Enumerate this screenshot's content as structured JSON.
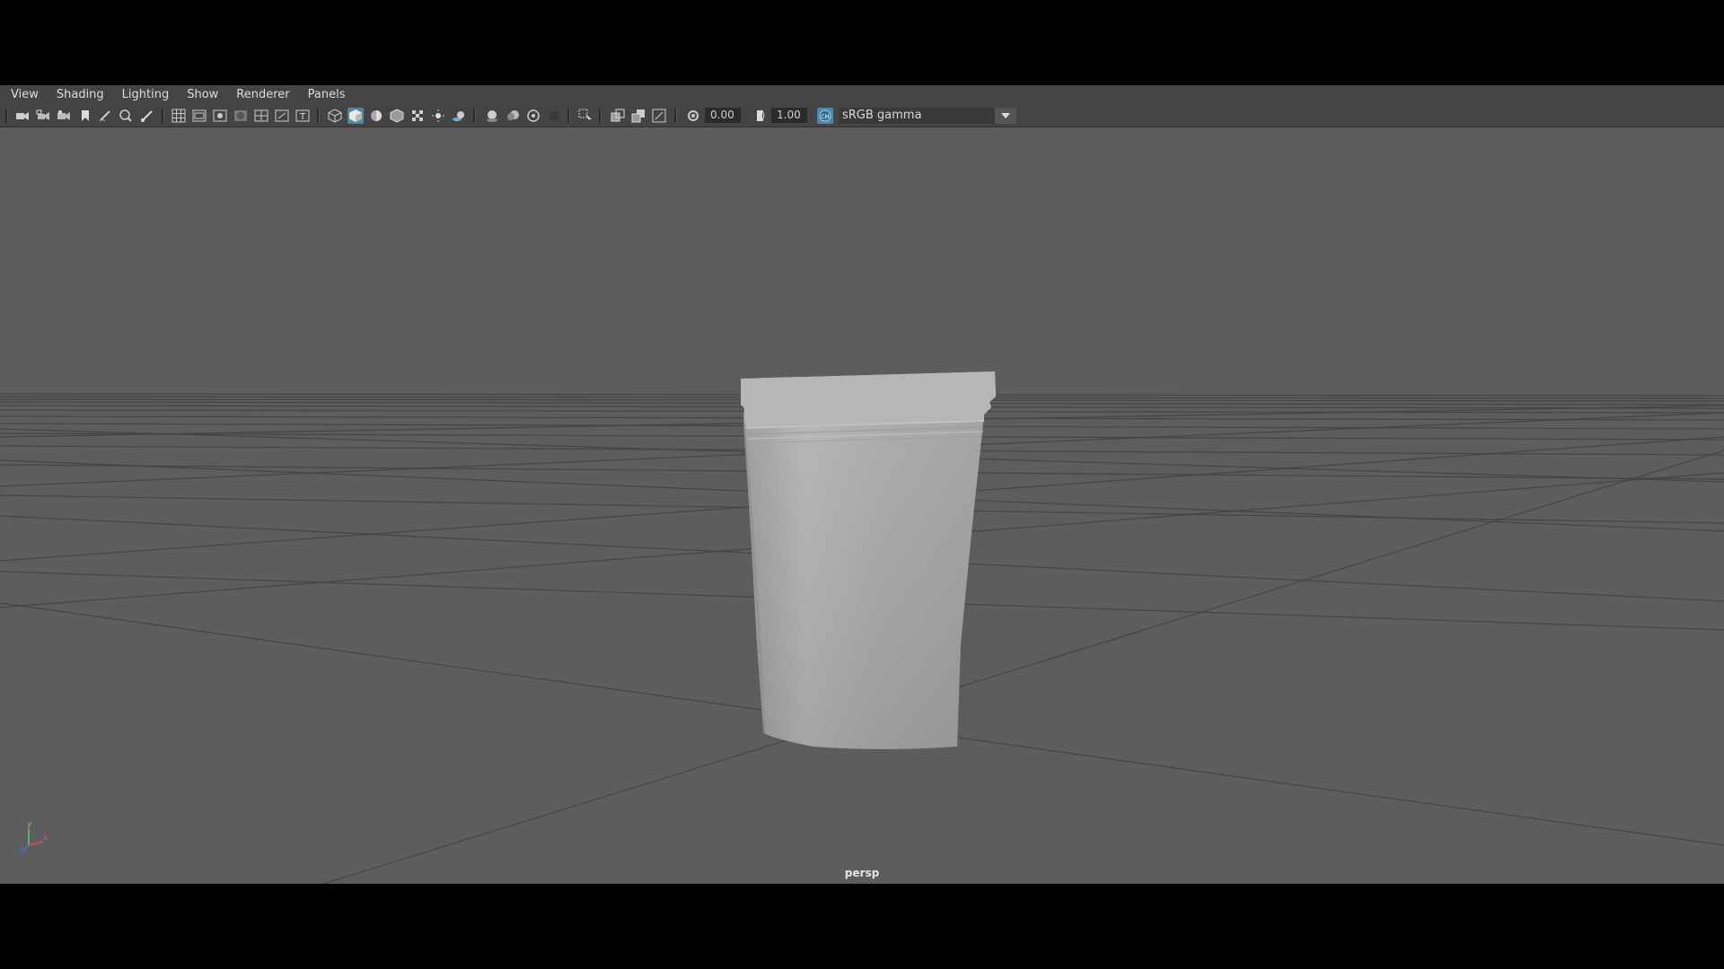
{
  "menubar": {
    "items": [
      "View",
      "Shading",
      "Lighting",
      "Show",
      "Renderer",
      "Panels"
    ]
  },
  "toolbar": {
    "exposure_value": "0.00",
    "gamma_value": "1.00",
    "color_space": "sRGB gamma",
    "icons": [
      "camera-select-icon",
      "camera-attributes-icon",
      "image-plane-icon",
      "bookmark-icon",
      "grease-pencil-icon",
      "two-d-pan-zoom-icon",
      "paint-icon",
      "grid-icon",
      "film-gate-icon",
      "resolution-gate-icon",
      "gate-mask-icon",
      "field-chart-icon",
      "safe-action-icon",
      "safe-title-icon",
      "wireframe-icon",
      "smooth-shade-icon",
      "use-default-material-icon",
      "wireframe-on-shaded-icon",
      "textured-icon",
      "use-all-lights-icon",
      "shadows-icon",
      "screen-space-ao-icon",
      "motion-blur-icon",
      "anti-aliasing-icon",
      "depth-of-field-icon",
      "isolate-select-icon",
      "x-ray-icon",
      "x-ray-joints-icon",
      "backface-culling-icon",
      "exposure-icon",
      "gamma-icon",
      "color-management-icon"
    ],
    "colors": {
      "active_highlight": "#5285a6",
      "toolbar_bg": "#444444",
      "viewport_bg": "#5d5d5d"
    }
  },
  "viewport": {
    "camera_name": "persp"
  }
}
